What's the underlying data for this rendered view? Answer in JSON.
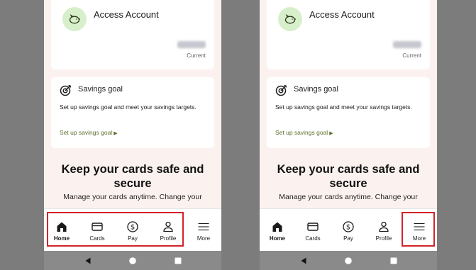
{
  "colors": {
    "highlight_border": "#d2232a",
    "link": "#5b6f2c",
    "icon_bg": "#d7efcb",
    "page_bg": "#fbf2ef"
  },
  "panels": [
    {
      "account": {
        "icon": "piggy-bank-icon",
        "title": "Access Account",
        "status": "Current"
      },
      "savings": {
        "icon": "target-icon",
        "title": "Savings goal",
        "description": "Set up savings goal and meet your savings targets.",
        "link": "Set up savings goal"
      },
      "promo": {
        "title": "Keep your cards safe and secure",
        "text": "Manage your cards anytime. Change your"
      },
      "nav": [
        {
          "label": "Home",
          "icon": "home-icon",
          "active": true
        },
        {
          "label": "Cards",
          "icon": "card-icon",
          "active": false
        },
        {
          "label": "Pay",
          "icon": "dollar-coin-icon",
          "active": false
        },
        {
          "label": "Profile",
          "icon": "person-icon",
          "active": false
        },
        {
          "label": "More",
          "icon": "menu-icon",
          "active": false
        }
      ],
      "highlighted": "Home, Cards, Pay, Profile"
    },
    {
      "account": {
        "icon": "piggy-bank-icon",
        "title": "Access Account",
        "status": "Current"
      },
      "savings": {
        "icon": "target-icon",
        "title": "Savings goal",
        "description": "Set up savings goal and meet your savings targets.",
        "link": "Set up savings goal"
      },
      "promo": {
        "title": "Keep your cards safe and secure",
        "text": "Manage your cards anytime. Change your"
      },
      "nav": [
        {
          "label": "Home",
          "icon": "home-icon",
          "active": true
        },
        {
          "label": "Cards",
          "icon": "card-icon",
          "active": false
        },
        {
          "label": "Pay",
          "icon": "dollar-coin-icon",
          "active": false
        },
        {
          "label": "Profile",
          "icon": "person-icon",
          "active": false
        },
        {
          "label": "More",
          "icon": "menu-icon",
          "active": false
        }
      ],
      "highlighted": "More"
    }
  ],
  "system_nav": [
    {
      "icon": "back-triangle-icon"
    },
    {
      "icon": "home-circle-icon"
    },
    {
      "icon": "recents-square-icon"
    }
  ]
}
